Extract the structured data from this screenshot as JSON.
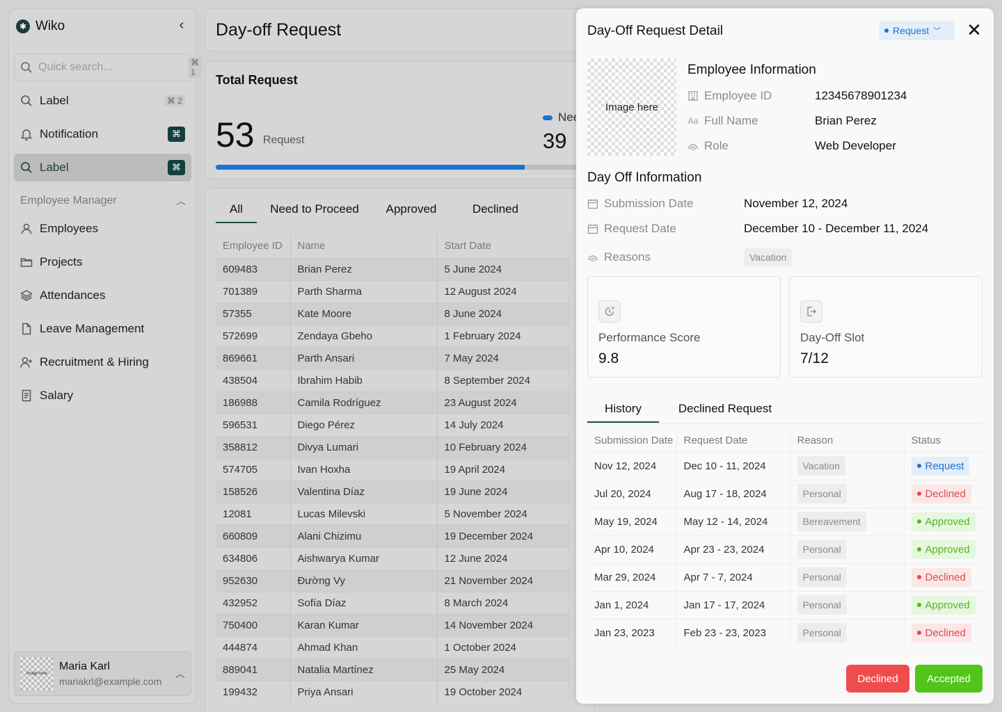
{
  "app": {
    "name": "Wiko"
  },
  "sidebar": {
    "search": {
      "placeholder": "Quick search...",
      "shortcut": "⌘ 1"
    },
    "items": [
      {
        "label": "Label",
        "shortcut": "⌘ 2"
      },
      {
        "label": "Notification",
        "shortcut": "⌘"
      },
      {
        "label": "Label",
        "shortcut": "⌘"
      }
    ],
    "section": {
      "title": "Employee Manager",
      "items": [
        "Employees",
        "Projects",
        "Attendances",
        "Leave Management",
        "Recruitment & Hiring",
        "Salary"
      ]
    },
    "user": {
      "avatar_text": "image here",
      "name": "Maria Karl",
      "email": "mariakrl@example.com"
    }
  },
  "main": {
    "title": "Day-off Request",
    "total": {
      "title": "Total Request",
      "count": "53",
      "unit": "Request",
      "need_label": "Nee",
      "need_value": "39",
      "progress_fraction": 0.74
    },
    "tabs": [
      "All",
      "Need to Proceed",
      "Approved",
      "Declined"
    ],
    "table": {
      "columns": [
        "Employee ID",
        "Name",
        "Start Date"
      ],
      "rows": [
        [
          "609483",
          "Brian Perez",
          "5 June 2024"
        ],
        [
          "701389",
          "Parth Sharma",
          "12 August 2024"
        ],
        [
          "57355",
          "Kate Moore",
          "8 June 2024"
        ],
        [
          "572699",
          "Zendaya Gbeho",
          "1 February 2024"
        ],
        [
          "869661",
          "Parth Ansari",
          "7 May 2024"
        ],
        [
          "438504",
          "Ibrahim Habib",
          "8 September 2024"
        ],
        [
          "186988",
          "Camila Rodríguez",
          "23 August 2024"
        ],
        [
          "596531",
          "Diego Pérez",
          "14 July 2024"
        ],
        [
          "358812",
          "Divya Lumari",
          "10 February 2024"
        ],
        [
          "574705",
          "Ivan Hoxha",
          "19 April 2024"
        ],
        [
          "158526",
          "Valentina Díaz",
          "19 June 2024"
        ],
        [
          "12081",
          "Lucas Milevski",
          "5 November 2024"
        ],
        [
          "660809",
          "Alani Chizimu",
          "19 December 2024"
        ],
        [
          "634806",
          "Aishwarya Kumar",
          "12 June 2024"
        ],
        [
          "952630",
          "Đường Vy",
          "21 November 2024"
        ],
        [
          "432952",
          "Sofía Díaz",
          "8 March 2024"
        ],
        [
          "750400",
          "Karan Kumar",
          "14 November 2024"
        ],
        [
          "444874",
          "Ahmad Khan",
          "1 October 2024"
        ],
        [
          "889041",
          "Natalia Martínez",
          "25 May 2024"
        ],
        [
          "199432",
          "Priya Ansari",
          "19 October 2024"
        ]
      ]
    }
  },
  "detail": {
    "title": "Day-Off Request Detail",
    "status": "Request",
    "photo_text": "Image here",
    "employee": {
      "heading": "Employee Information",
      "fields": [
        {
          "label": "Employee ID",
          "value": "12345678901234",
          "icon": "building-icon"
        },
        {
          "label": "Full Name",
          "value": "Brian Perez",
          "icon": "text-aa-icon"
        },
        {
          "label": "Role",
          "value": "Web Developer",
          "icon": "fingerprint-icon"
        }
      ]
    },
    "dayoff": {
      "heading": "Day Off Information",
      "submission_label": "Submission Date",
      "submission_value": "November 12, 2024",
      "request_label": "Request Date",
      "request_value": "December 10 - December 11, 2024",
      "reasons_label": "Reasons",
      "reasons_value": "Vacation"
    },
    "stats": [
      {
        "label": "Performance Score",
        "value": "9.8",
        "icon": "score-icon"
      },
      {
        "label": "Day-Off Slot",
        "value": "7/12",
        "icon": "exit-icon"
      }
    ],
    "tabs": [
      "History",
      "Declined Request"
    ],
    "history": {
      "columns": [
        "Submission Date",
        "Request Date",
        "Reason",
        "Status"
      ],
      "rows": [
        {
          "submitted": "Nov 12, 2024",
          "requested": "Dec 10 - 11, 2024",
          "reason": "Vacation",
          "status": "Request",
          "kind": "request"
        },
        {
          "submitted": "Jul 20, 2024",
          "requested": "Aug 17 - 18, 2024",
          "reason": "Personal",
          "status": "Declined",
          "kind": "declined"
        },
        {
          "submitted": "May 19, 2024",
          "requested": "May 12 - 14, 2024",
          "reason": "Bereavement",
          "status": "Approved",
          "kind": "approved"
        },
        {
          "submitted": "Apr 10, 2024",
          "requested": "Apr 23 - 23, 2024",
          "reason": "Personal",
          "status": "Approved",
          "kind": "approved"
        },
        {
          "submitted": "Mar 29, 2024",
          "requested": "Apr 7 -  7, 2024",
          "reason": "Personal",
          "status": "Declined",
          "kind": "declined"
        },
        {
          "submitted": "Jan 1, 2024",
          "requested": "Jan 17 - 17, 2024",
          "reason": "Personal",
          "status": "Approved",
          "kind": "approved"
        },
        {
          "submitted": "Jan 23, 2023",
          "requested": "Feb 23 - 23, 2023",
          "reason": "Personal",
          "status": "Declined",
          "kind": "declined"
        }
      ]
    },
    "actions": {
      "decline_label": "Declined",
      "accept_label": "Accepted"
    }
  },
  "colors": {
    "accent": "#1a73d1",
    "brand": "#1d3a36",
    "declined": "#e5484d",
    "approved": "#52c41a"
  }
}
